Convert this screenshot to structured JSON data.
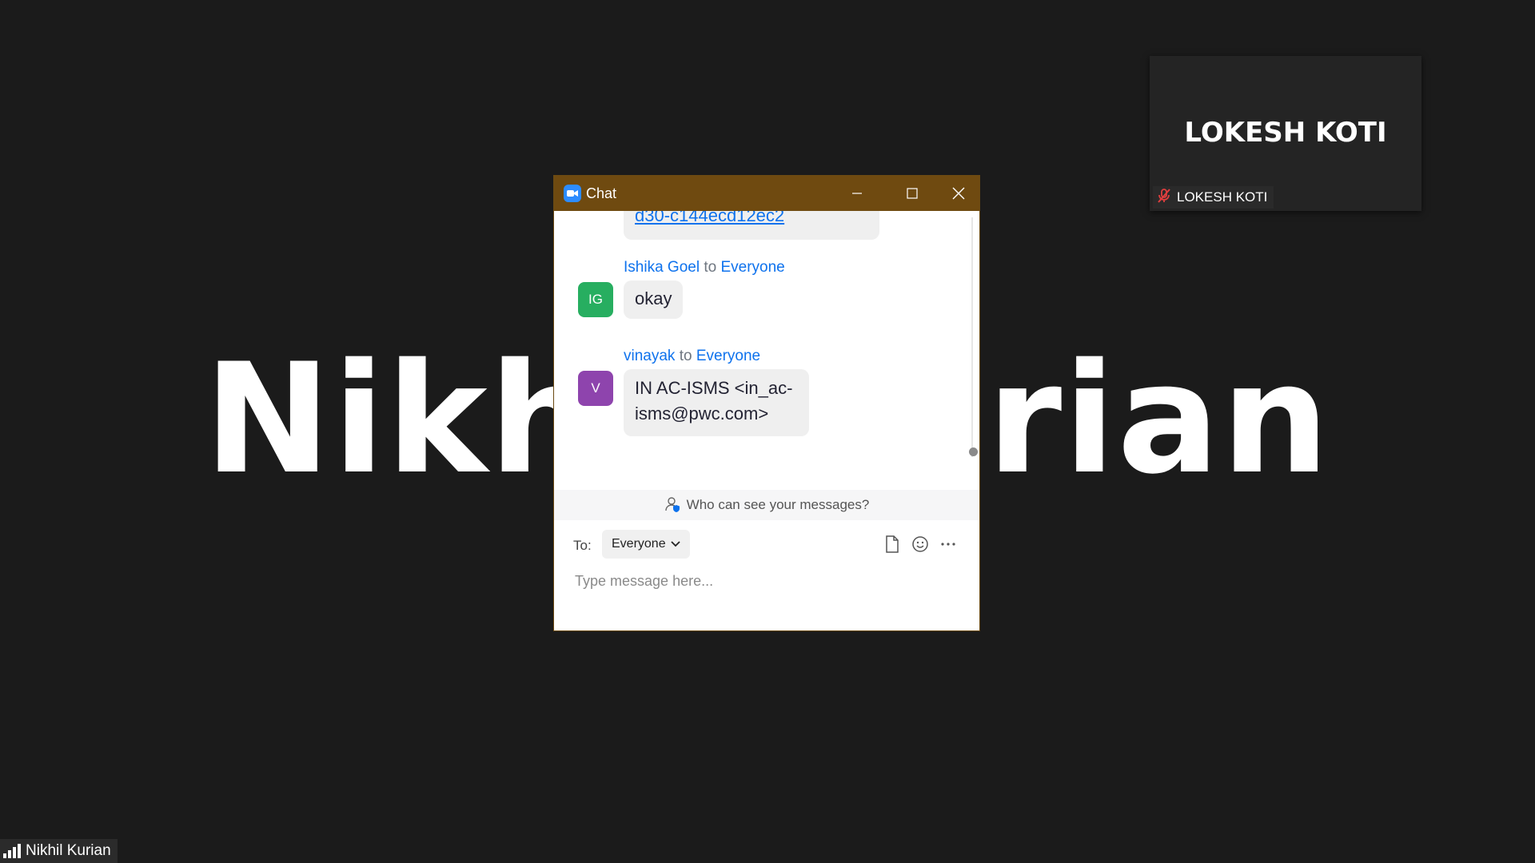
{
  "background": {
    "speaker_name": "Nikhil Kurian"
  },
  "participant_tile": {
    "display_name": "LOKESH KOTI",
    "label": "LOKESH KOTI",
    "muted": true
  },
  "self_label": {
    "name": "Nikhil Kurian"
  },
  "chat_window": {
    "title": "Chat",
    "messages": [
      {
        "partial_link": "d30-c144ecd12ec2"
      },
      {
        "sender": "Ishika Goel",
        "to_word": "to",
        "recipient": "Everyone",
        "avatar_initials": "IG",
        "avatar_color": "#27ae60",
        "text": "okay"
      },
      {
        "sender": "vinayak",
        "to_word": "to",
        "recipient": "Everyone",
        "avatar_initials": "V",
        "avatar_color": "#8e44ad",
        "text_line1": "IN AC-ISMS <in_ac-",
        "text_line2": "isms@pwc.com>"
      }
    ],
    "notice": "Who can see your messages?",
    "compose": {
      "to_label": "To:",
      "recipient": "Everyone",
      "placeholder": "Type message here..."
    }
  },
  "colors": {
    "titlebar": "#6f4a10",
    "link": "#0e72ed",
    "background": "#1b1b1b"
  }
}
